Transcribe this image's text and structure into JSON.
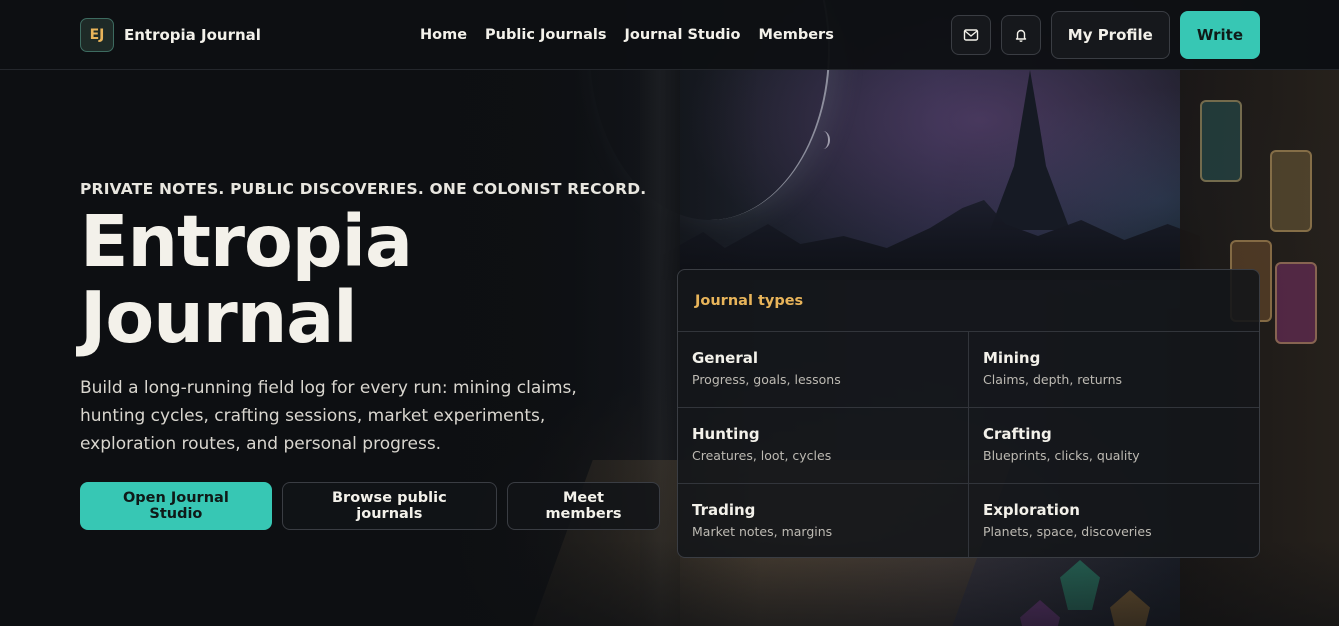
{
  "brand": {
    "badge": "EJ",
    "name": "Entropia Journal"
  },
  "nav": {
    "links": [
      {
        "label": "Home"
      },
      {
        "label": "Public Journals"
      },
      {
        "label": "Journal Studio"
      },
      {
        "label": "Members"
      }
    ],
    "profile_label": "My Profile",
    "write_label": "Write"
  },
  "hero": {
    "eyebrow": "PRIVATE NOTES. PUBLIC DISCOVERIES. ONE COLONIST RECORD.",
    "title_line1": "Entropia",
    "title_line2": "Journal",
    "description": "Build a long-running field log for every run: mining claims, hunting cycles, crafting sessions, market experiments, exploration routes, and personal progress.",
    "cta": {
      "primary": "Open Journal Studio",
      "secondary": "Browse public journals",
      "tertiary": "Meet members"
    }
  },
  "journal_types": {
    "title": "Journal types",
    "items": [
      {
        "name": "General",
        "desc": "Progress, goals, lessons"
      },
      {
        "name": "Mining",
        "desc": "Claims, depth, returns"
      },
      {
        "name": "Hunting",
        "desc": "Creatures, loot, cycles"
      },
      {
        "name": "Crafting",
        "desc": "Blueprints, clicks, quality"
      },
      {
        "name": "Trading",
        "desc": "Market notes, margins"
      },
      {
        "name": "Exploration",
        "desc": "Planets, space, discoveries"
      }
    ]
  },
  "icons": {
    "mail": "mail-icon",
    "notifications": "bell-icon"
  },
  "colors": {
    "accent": "#37c7b4",
    "highlight": "#e8b45a",
    "background": "#0d0f12"
  }
}
